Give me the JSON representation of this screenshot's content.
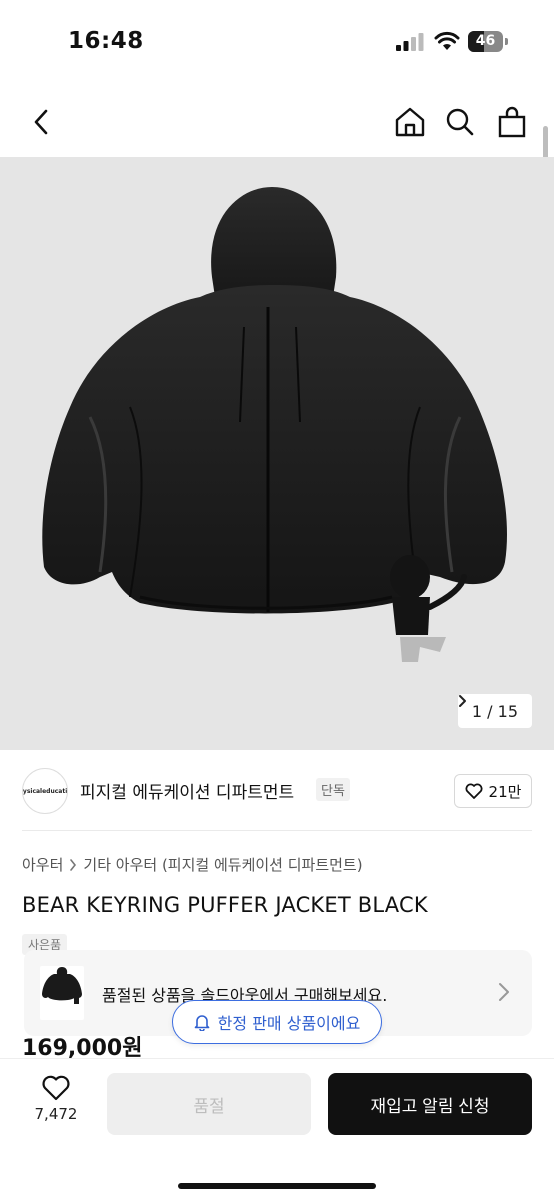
{
  "status_bar": {
    "time": "16:48",
    "battery_level": "46",
    "battery_fraction": 0.46,
    "icons": [
      "cellular-signal-icon",
      "wifi-icon",
      "battery-icon"
    ]
  },
  "nav": {
    "icons": [
      "chevron-left-icon",
      "home-icon",
      "search-icon",
      "shopping-bag-icon"
    ]
  },
  "gallery": {
    "counter": "1 / 15",
    "background": "#e5e5e5"
  },
  "brand": {
    "logo_text": "physicaleducation",
    "name": "피지컬 에듀케이션 디파트먼트",
    "badge": "단독",
    "likes": "21만"
  },
  "product": {
    "breadcrumb": [
      "아우터",
      "기타 아우터 (피지컬 에듀케이션 디파트먼트)"
    ],
    "title": "BEAR KEYRING PUFFER JACKET BLACK",
    "tag": "사은품",
    "price": "169,000원"
  },
  "soldout_banner": {
    "text": "품절된 상품을 솔드아웃에서 구매해보세요."
  },
  "limited_pill": {
    "text": "한정 판매 상품이에요",
    "color": "#3d6ee0"
  },
  "bottom_bar": {
    "wish_count": "7,472",
    "soldout_label": "품절",
    "restock_label": "재입고 알림 신청"
  }
}
